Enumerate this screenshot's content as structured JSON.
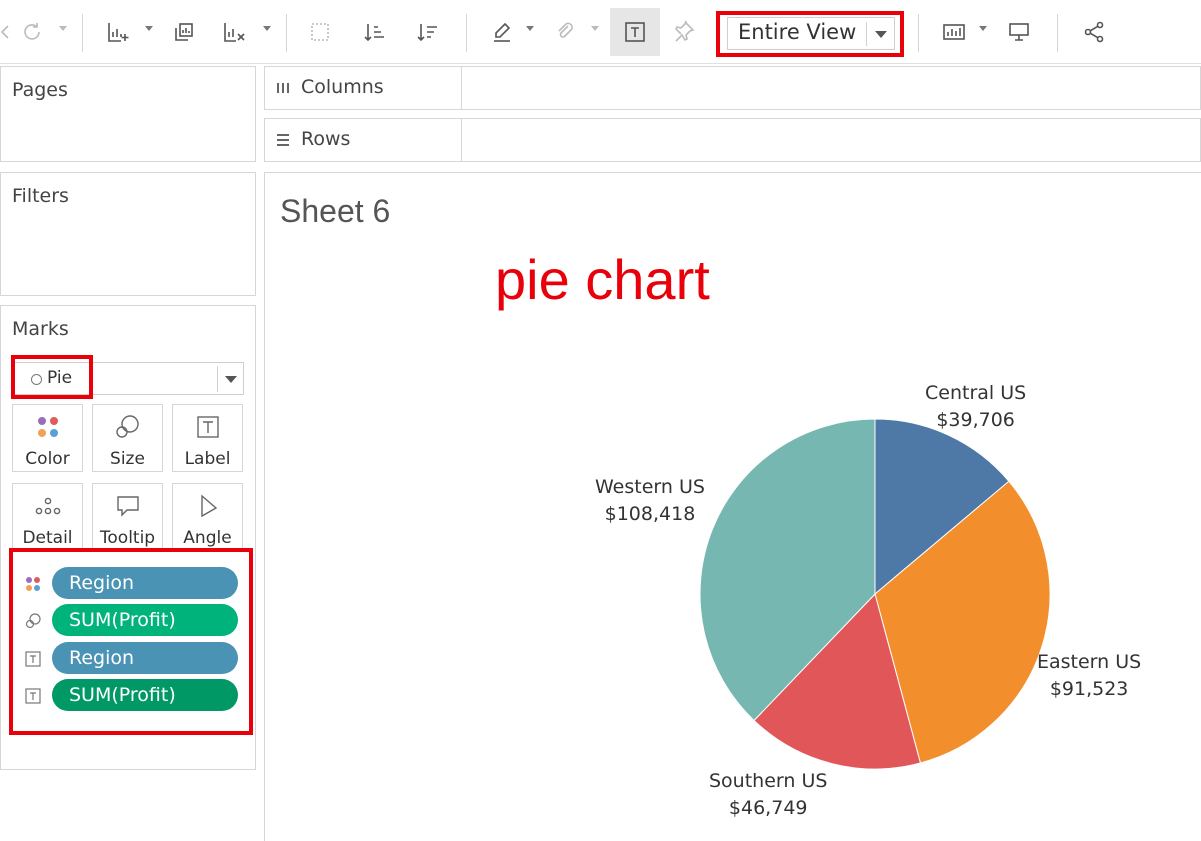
{
  "toolbar": {
    "fit_value": "Entire View"
  },
  "panels": {
    "pages": "Pages",
    "filters": "Filters",
    "marks": "Marks"
  },
  "marks": {
    "mark_type": "Pie",
    "buttons": {
      "color": "Color",
      "size": "Size",
      "label": "Label",
      "detail": "Detail",
      "tooltip": "Tooltip",
      "angle": "Angle"
    },
    "fields": [
      {
        "icon": "color-icon",
        "label": "Region",
        "color": "#4a93b4"
      },
      {
        "icon": "size-icon",
        "label": "SUM(Profit)",
        "color": "#00b37a"
      },
      {
        "icon": "label-icon",
        "label": "Region",
        "color": "#4a93b4"
      },
      {
        "icon": "label-icon",
        "label": "SUM(Profit)",
        "color": "#009966"
      }
    ]
  },
  "shelves": {
    "columns": "Columns",
    "rows": "Rows"
  },
  "view": {
    "sheet_title": "Sheet 6",
    "annotation": "pie chart"
  },
  "chart_data": {
    "type": "pie",
    "title": "",
    "slices": [
      {
        "name": "Central US",
        "value": 39706,
        "label": "$39,706",
        "color": "#4e79a7"
      },
      {
        "name": "Eastern US",
        "value": 91523,
        "label": "$91,523",
        "color": "#f28e2b"
      },
      {
        "name": "Southern US",
        "value": 46749,
        "label": "$46,749",
        "color": "#e15759"
      },
      {
        "name": "Western US",
        "value": 108418,
        "label": "$108,418",
        "color": "#76b7b2"
      }
    ]
  }
}
